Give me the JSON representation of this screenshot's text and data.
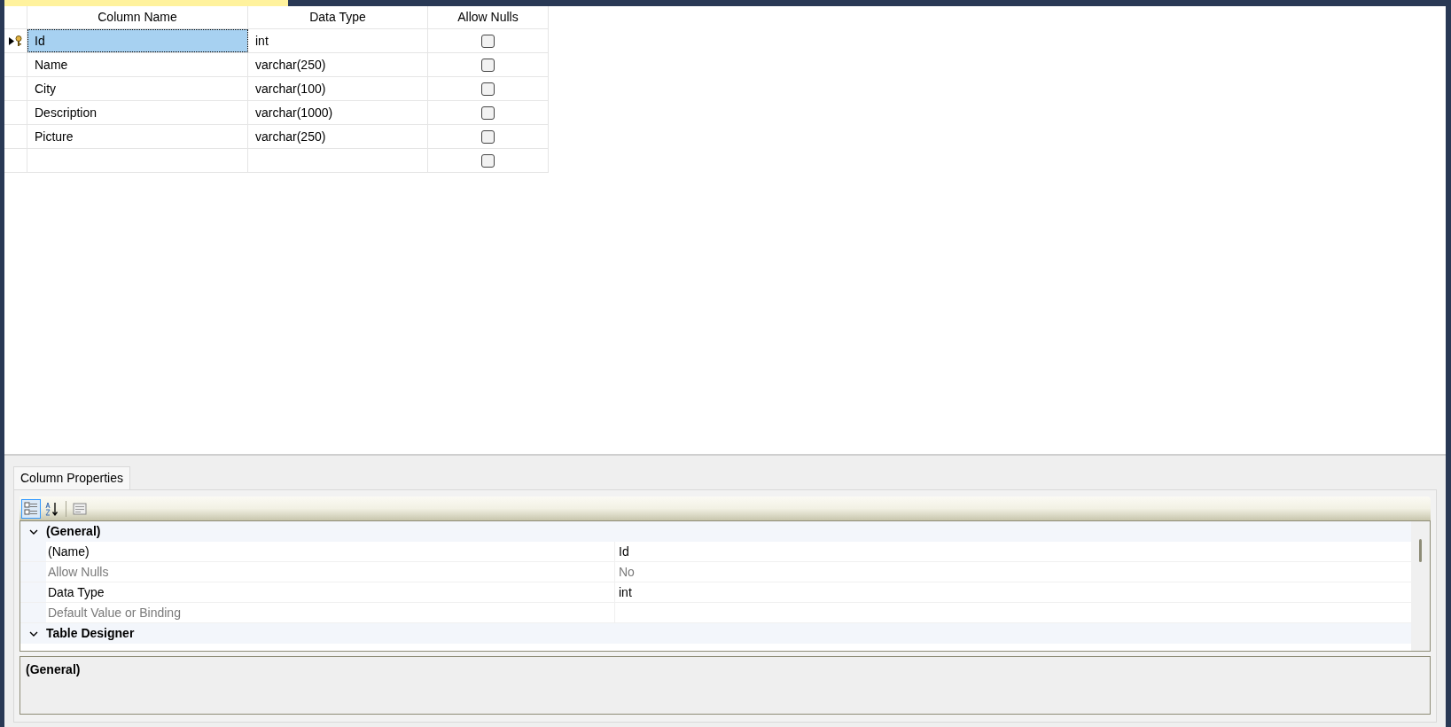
{
  "grid": {
    "columns": [
      "Column Name",
      "Data Type",
      "Allow Nulls"
    ],
    "rows": [
      {
        "name": "Id",
        "type": "int",
        "allow_nulls": false,
        "primary_key": true,
        "selected": true
      },
      {
        "name": "Name",
        "type": "varchar(250)",
        "allow_nulls": false,
        "primary_key": false,
        "selected": false
      },
      {
        "name": "City",
        "type": "varchar(100)",
        "allow_nulls": false,
        "primary_key": false,
        "selected": false
      },
      {
        "name": "Description",
        "type": "varchar(1000)",
        "allow_nulls": false,
        "primary_key": false,
        "selected": false
      },
      {
        "name": "Picture",
        "type": "varchar(250)",
        "allow_nulls": false,
        "primary_key": false,
        "selected": false
      },
      {
        "allow_nulls": false,
        "primary_key": false,
        "selected": false
      }
    ]
  },
  "properties": {
    "tab": {
      "label": "Column Properties",
      "selected": true
    },
    "toolbar": [
      {
        "kind": "categorized",
        "selected": true
      },
      {
        "kind": "alphabetical",
        "selected": false
      },
      {
        "kind": "pages",
        "selected": false
      }
    ],
    "categories": [
      {
        "name": "(General)",
        "expanded": true,
        "children": [
          {
            "name": "(Name)",
            "value": "Id",
            "disabled": false
          },
          {
            "name": "Allow Nulls",
            "value": "No",
            "disabled": true
          },
          {
            "name": "Data Type",
            "value": "int",
            "disabled": false
          },
          {
            "name": "Default Value or Binding",
            "disabled": true
          }
        ]
      },
      {
        "name": "Table Designer",
        "expanded": true
      }
    ],
    "description": "(General)"
  }
}
